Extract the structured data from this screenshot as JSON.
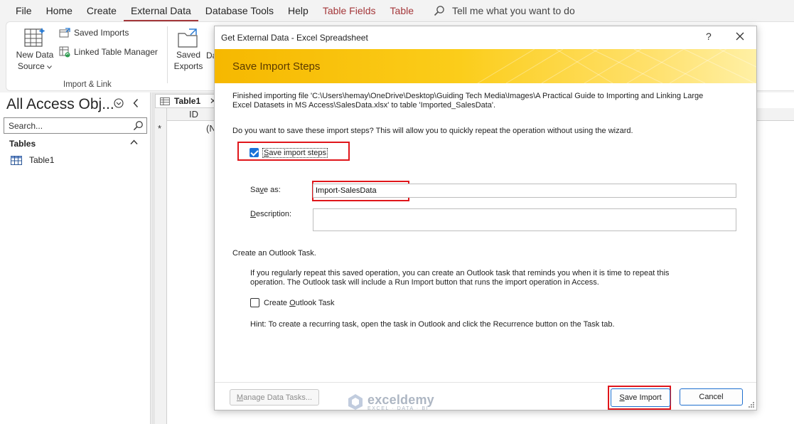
{
  "menubar": {
    "items": [
      "File",
      "Home",
      "Create",
      "External Data",
      "Database Tools",
      "Help",
      "Table Fields",
      "Table"
    ],
    "active": "External Data",
    "tell_me": "Tell me what you want to do"
  },
  "ribbon": {
    "new_data_source_line1": "New Data",
    "new_data_source_line2": "Source",
    "saved_imports": "Saved Imports",
    "linked_table_manager": "Linked Table Manager",
    "group_import_link": "Import & Link",
    "saved_exports_line1": "Saved",
    "saved_exports_line2": "Exports",
    "clipped_label": "Da"
  },
  "nav": {
    "title": "All Access Obj...",
    "search_placeholder": "Search...",
    "section": "Tables",
    "items": [
      "Table1"
    ]
  },
  "datasheet": {
    "tab": "Table1",
    "column": "ID",
    "new_row_marker": "*",
    "new_row_value": "(N"
  },
  "dialog": {
    "title": "Get External Data - Excel Spreadsheet",
    "help": "?",
    "banner_title": "Save Import Steps",
    "finished_line1": "Finished importing file 'C:\\Users\\hemay\\OneDrive\\Desktop\\Guiding Tech Media\\Images\\A Practical Guide to Importing and Linking Large",
    "finished_line2": "Excel Datasets in MS Access\\SalesData.xlsx' to table 'Imported_SalesData'.",
    "question": "Do you want to save these import steps? This will allow you to quickly repeat the operation without using the wizard.",
    "save_steps_label": "Save import steps",
    "save_steps_checked": true,
    "save_as_label": "Save as:",
    "save_as_value": "Import-SalesData",
    "description_label": "Description:",
    "description_value": "",
    "outlook_heading": "Create an Outlook Task.",
    "outlook_line1": "If you regularly repeat this saved operation, you can create an Outlook task that reminds you when it is time to repeat this",
    "outlook_line2": "operation. The Outlook task will include a Run Import button that runs the import operation in Access.",
    "outlook_checkbox_label": "Create Outlook Task",
    "outlook_checked": false,
    "hint": "Hint: To create a recurring task, open the task in Outlook and click the Recurrence button on the Task tab.",
    "manage_button": "Manage Data Tasks...",
    "save_import_button": "Save Import",
    "cancel_button": "Cancel"
  },
  "watermark": {
    "name": "exceldemy",
    "tagline": "EXCEL · DATA · BI"
  },
  "colors": {
    "accent_red": "#a4373a",
    "highlight_red": "#e0161b",
    "banner_yellow": "#f6b800",
    "checkbox_blue": "#1a73d9"
  }
}
